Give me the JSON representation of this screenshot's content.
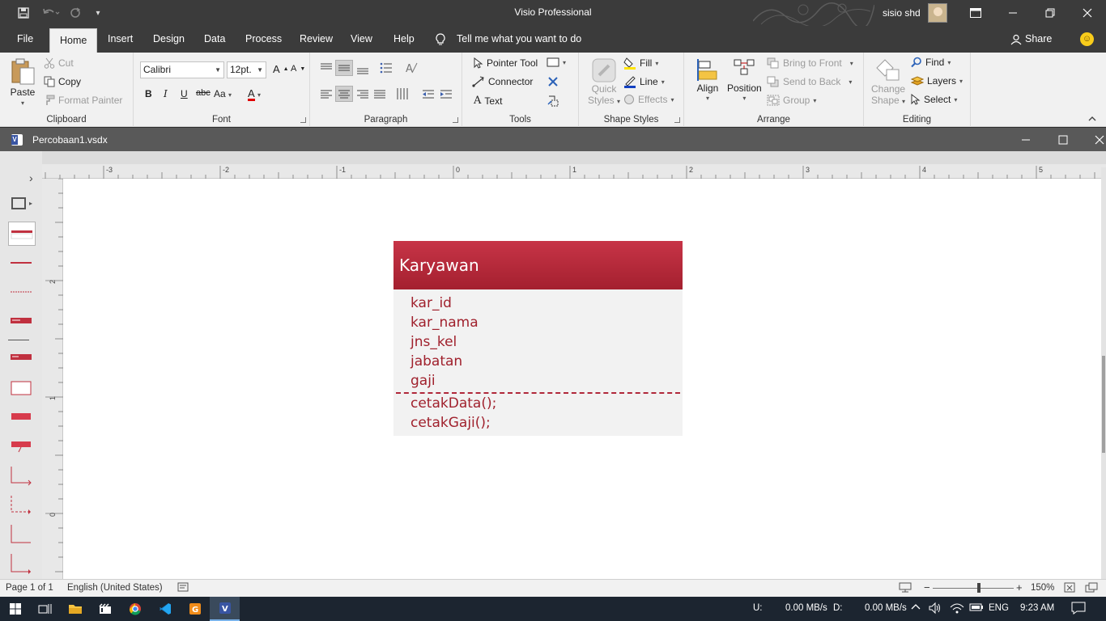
{
  "titlebar": {
    "app_title": "Visio Professional",
    "user_name": "sisio shd"
  },
  "menu": {
    "tabs": [
      "File",
      "Home",
      "Insert",
      "Design",
      "Data",
      "Process",
      "Review",
      "View",
      "Help"
    ],
    "tell_me": "Tell me what you want to do",
    "share": "Share"
  },
  "ribbon": {
    "clipboard": {
      "label": "Clipboard",
      "paste": "Paste",
      "cut": "Cut",
      "copy": "Copy",
      "format_painter": "Format Painter"
    },
    "font": {
      "label": "Font",
      "font_name": "Calibri",
      "font_size": "12pt.",
      "bold": "B",
      "italic": "I",
      "underline": "U",
      "strike": "abc",
      "case": "Aa"
    },
    "paragraph": {
      "label": "Paragraph"
    },
    "tools": {
      "label": "Tools",
      "pointer_tool": "Pointer Tool",
      "connector": "Connector",
      "text": "Text"
    },
    "shape_styles": {
      "label": "Shape Styles",
      "quick_styles_1": "Quick",
      "quick_styles_2": "Styles",
      "fill": "Fill",
      "line": "Line",
      "effects": "Effects"
    },
    "arrange": {
      "label": "Arrange",
      "align": "Align",
      "position": "Position",
      "bring_to_front": "Bring to Front",
      "send_to_back": "Send to Back",
      "group": "Group"
    },
    "editing": {
      "label": "Editing",
      "change_shape_1": "Change",
      "change_shape_2": "Shape",
      "find": "Find",
      "layers": "Layers",
      "select": "Select"
    }
  },
  "document": {
    "title": "Percobaan1.vsdx"
  },
  "ruler": {
    "h_labels": [
      "-3",
      "-2",
      "-1",
      "0",
      "1",
      "2",
      "3",
      "4",
      "5"
    ],
    "v_labels": [
      "2",
      "1",
      "0"
    ]
  },
  "diagram": {
    "class_name": "Karyawan",
    "attributes": [
      "kar_id",
      "kar_nama",
      "jns_kel",
      "jabatan",
      "gaji"
    ],
    "operations": [
      "cetakData();",
      "cetakGaji();"
    ],
    "header_color": "#b7293a",
    "text_color": "#a0212d"
  },
  "statusbar": {
    "page": "Page 1 of 1",
    "language": "English (United States)",
    "zoom": "150%"
  },
  "taskbar": {
    "net_up_label": "U:",
    "net_up_value": "0.00 MB/s",
    "net_down_label": "D:",
    "net_down_value": "0.00 MB/s",
    "language": "ENG",
    "time": "9:23 AM"
  }
}
